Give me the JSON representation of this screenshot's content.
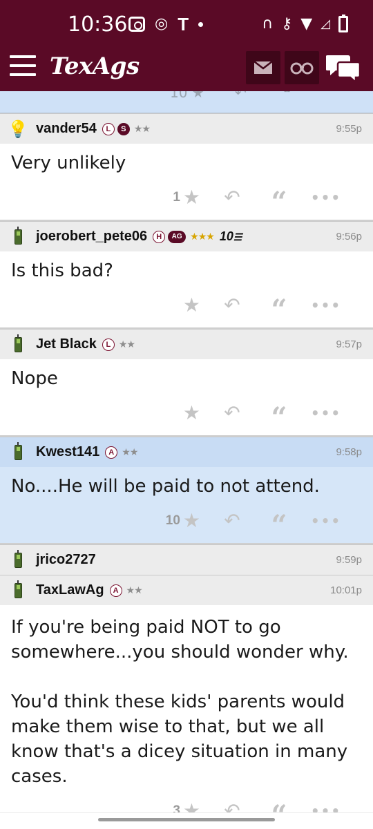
{
  "status_bar": {
    "time": "10:36",
    "carrier_letter": "T"
  },
  "header": {
    "logo": "TexAgs"
  },
  "posts": [
    {
      "avatar": "lightbulb-icon",
      "username": "vander54",
      "badges": [
        "L",
        "S"
      ],
      "stars": "★★",
      "time": "9:55p",
      "text": "Very unlikely",
      "likes": "1",
      "highlight": false
    },
    {
      "avatar": "phone-icon",
      "username": "joerobert_pete06",
      "badges": [
        "H",
        "AG"
      ],
      "stars": "★★★",
      "extra": "10",
      "time": "9:56p",
      "text": "Is this bad?",
      "likes": "",
      "highlight": false
    },
    {
      "avatar": "phone-icon",
      "username": "Jet Black",
      "badges": [
        "L"
      ],
      "stars": "★★",
      "time": "9:57p",
      "text": "Nope",
      "likes": "",
      "highlight": false
    },
    {
      "avatar": "phone-icon",
      "username": "Kwest141",
      "badges": [
        "A"
      ],
      "stars": "★★",
      "time": "9:58p",
      "text": "No....He will be paid to not attend.",
      "likes": "10",
      "highlight": true
    },
    {
      "avatar": "phone-icon",
      "username": "jrico2727",
      "badges": [],
      "stars": "",
      "time": "9:59p"
    },
    {
      "avatar": "phone-icon",
      "username": "TaxLawAg",
      "badges": [
        "A"
      ],
      "stars": "★★",
      "time": "10:01p",
      "text": "If you're being paid NOT to go somewhere...you should wonder why.\n\nYou'd think these kids' parents would make them wise to that, but we all know that's a dicey situation in many cases.",
      "likes": "3",
      "highlight": false
    }
  ],
  "action_icons": [
    "star-icon",
    "reply-icon",
    "quote-icon",
    "more-icon"
  ],
  "colors": {
    "header": "#5a0a26",
    "highlight": "#d6e6f8"
  }
}
